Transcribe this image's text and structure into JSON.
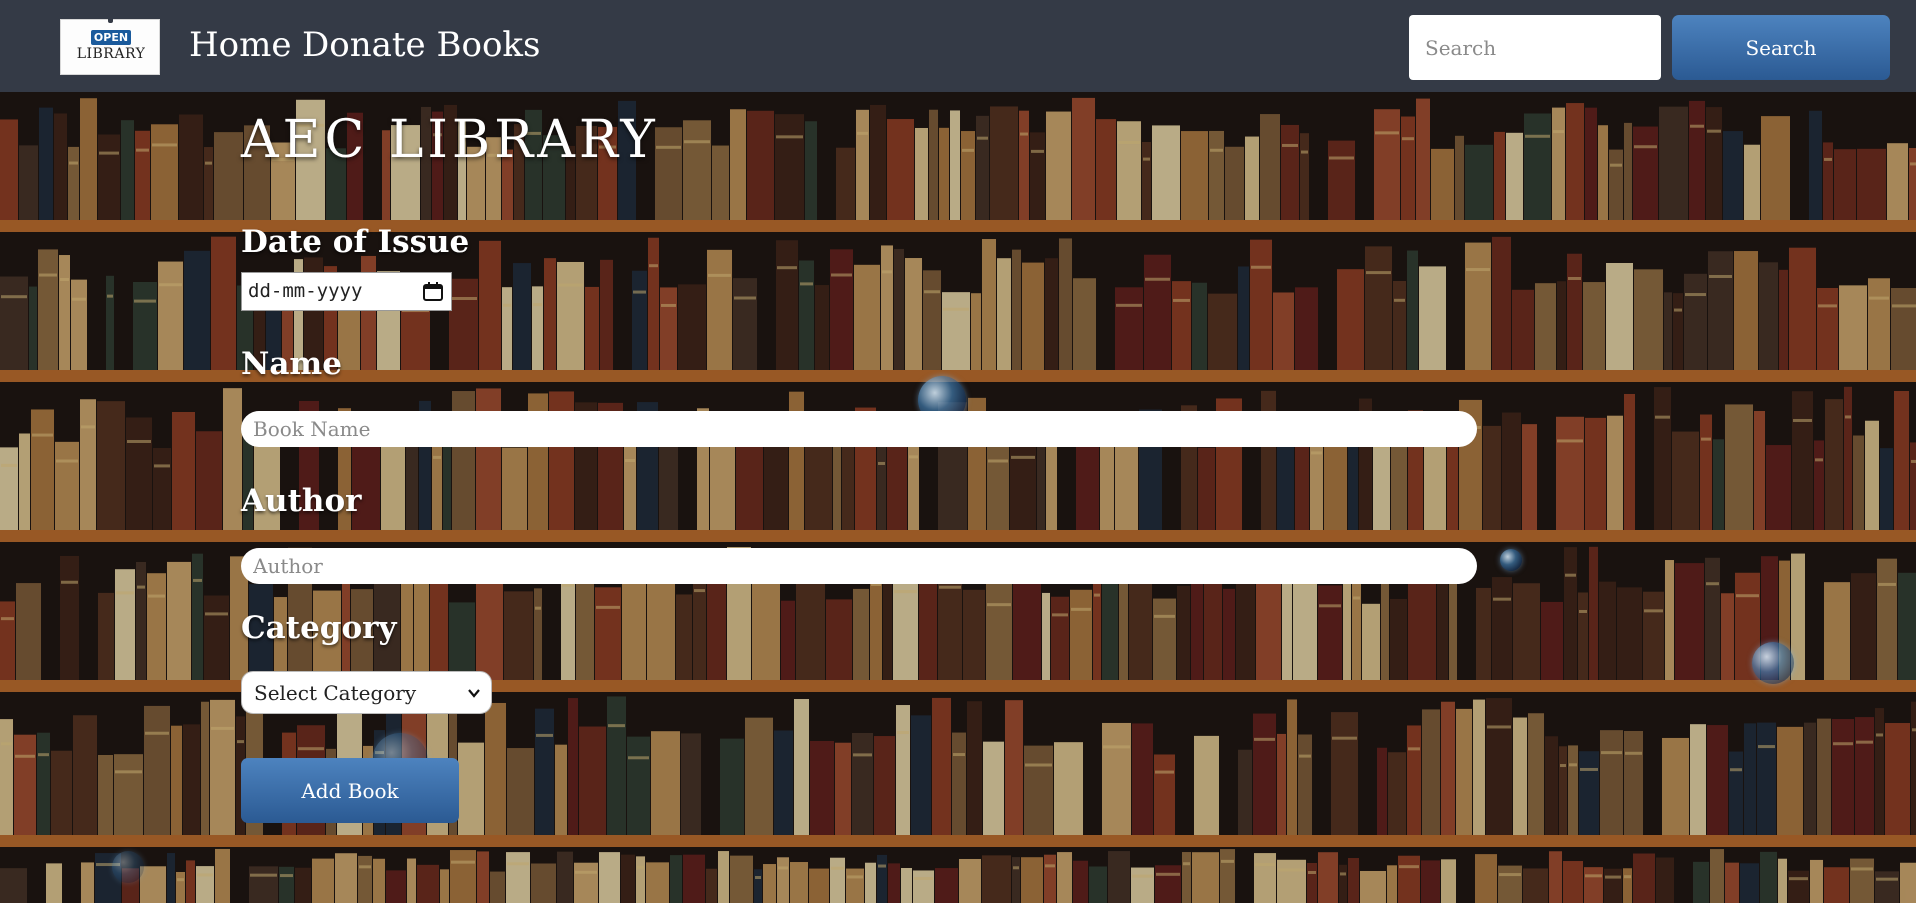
{
  "navbar": {
    "logo": {
      "badge": "OPEN",
      "word": "LIBRARY"
    },
    "links": {
      "home": "Home",
      "donate": "Donate Books"
    },
    "search": {
      "placeholder": "Search",
      "button_label": "Search"
    }
  },
  "main": {
    "title": "AEC LIBRARY",
    "form": {
      "date_label": "Date of Issue",
      "date_value": "dd-mm-yyyy",
      "name_label": "Name",
      "name_placeholder": "Book Name",
      "author_label": "Author",
      "author_placeholder": "Author",
      "category_label": "Category",
      "category_selected": "Select Category",
      "submit_label": "Add Book"
    }
  },
  "icons": {
    "calendar": "calendar-icon",
    "chevron": "chevron-down-icon",
    "background": "bookshelf-background"
  },
  "colors": {
    "navbar": "#343a46",
    "button_top": "#4d83bf",
    "button_bottom": "#2b5a93",
    "text": "#ffffff"
  }
}
